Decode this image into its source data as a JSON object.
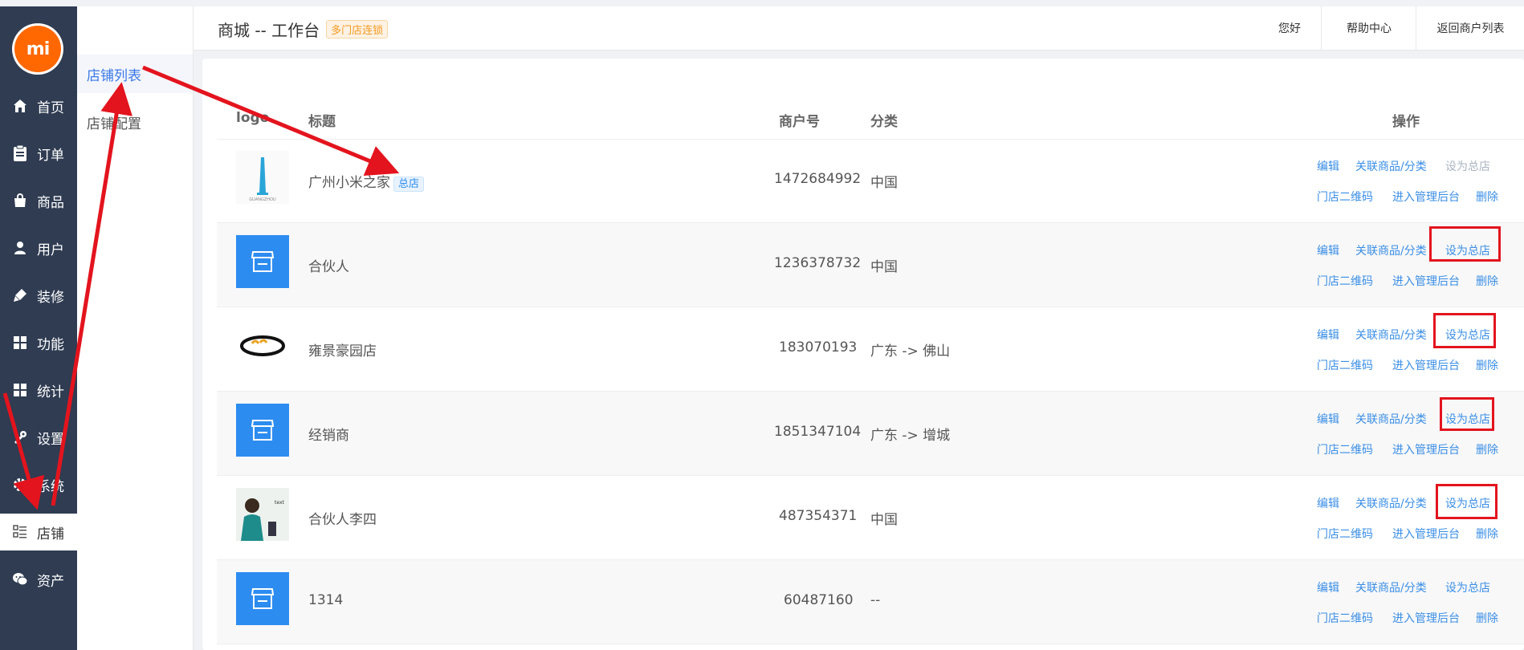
{
  "sidebar": {
    "logo_text": "mi",
    "items": [
      {
        "label": "首页",
        "icon": "home-icon"
      },
      {
        "label": "订单",
        "icon": "clipboard-icon"
      },
      {
        "label": "商品",
        "icon": "shopping-bag-icon"
      },
      {
        "label": "用户",
        "icon": "user-icon"
      },
      {
        "label": "装修",
        "icon": "paint-brush-icon"
      },
      {
        "label": "功能",
        "icon": "grid-icon"
      },
      {
        "label": "统计",
        "icon": "grid-icon"
      },
      {
        "label": "设置",
        "icon": "tools-icon"
      },
      {
        "label": "系统",
        "icon": "gear-icon"
      },
      {
        "label": "店铺",
        "icon": "list-icon"
      },
      {
        "label": "资产",
        "icon": "wechat-icon"
      }
    ]
  },
  "subnav": {
    "items": [
      {
        "label": "店铺列表"
      },
      {
        "label": "店铺配置"
      }
    ]
  },
  "header": {
    "title": "商城 -- 工作台",
    "tag": "多门店连锁",
    "buttons": [
      "您好",
      "帮助中心",
      "返回商户列表"
    ]
  },
  "table": {
    "columns": [
      "logo",
      "标题",
      "商户号",
      "分类",
      "操作"
    ],
    "rows": [
      {
        "title": "广州小米之家",
        "badge": "总店",
        "merchant_no": "1472684992",
        "category": "中国",
        "set_hq_disabled": true,
        "logo": "tower-image"
      },
      {
        "title": "合伙人",
        "badge": "",
        "merchant_no": "1236378732",
        "category": "中国",
        "set_hq_disabled": false,
        "logo": "store-icon"
      },
      {
        "title": "雍景豪园店",
        "badge": "",
        "merchant_no": "183070193",
        "category": "广东 -> 佛山",
        "set_hq_disabled": false,
        "logo": "bread-image"
      },
      {
        "title": "经销商",
        "badge": "",
        "merchant_no": "1851347104",
        "category": "广东 -> 增城",
        "set_hq_disabled": false,
        "logo": "store-icon"
      },
      {
        "title": "合伙人李四",
        "badge": "",
        "merchant_no": "487354371",
        "category": "中国",
        "set_hq_disabled": false,
        "logo": "person-image"
      },
      {
        "title": "1314",
        "badge": "",
        "merchant_no": "60487160",
        "category": "--",
        "set_hq_disabled": false,
        "logo": "store-icon"
      }
    ],
    "actions": {
      "edit": "编辑",
      "link": "关联商品/分类",
      "set_hq": "设为总店",
      "qrcode": "门店二维码",
      "admin": "进入管理后台",
      "delete": "删除"
    }
  },
  "colors": {
    "sidebar_bg": "#2f3c52",
    "link": "#3a8ee6",
    "highlight": "#e3141e",
    "brand": "#ff6700"
  }
}
